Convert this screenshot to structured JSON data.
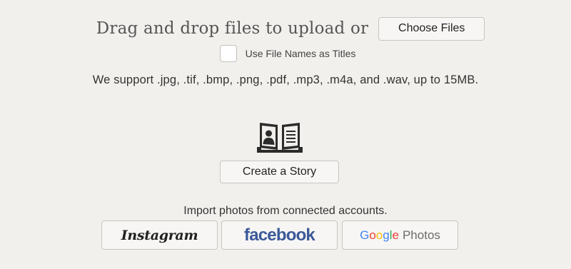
{
  "upload": {
    "title": "Drag and drop files to upload or",
    "choose_button": "Choose Files"
  },
  "options": {
    "use_file_names_label": "Use File Names as Titles",
    "use_file_names_checked": false
  },
  "support_text": "We support .jpg, .tif, .bmp, .png, .pdf, .mp3, .m4a, and .wav, up to 15MB.",
  "story": {
    "icon": "book-with-portrait-icon",
    "button": "Create a Story"
  },
  "import": {
    "label": "Import photos from connected accounts.",
    "instagram": "Instagram",
    "facebook": "facebook",
    "google": {
      "letters": [
        "G",
        "o",
        "o",
        "g",
        "l",
        "e"
      ],
      "suffix": "Photos"
    }
  },
  "colors": {
    "background": "#f2f0ed",
    "facebook_blue": "#3b5998",
    "google_blue": "#4285f4",
    "google_red": "#ea4335",
    "google_yellow": "#fbbc05",
    "google_green": "#34a853"
  }
}
